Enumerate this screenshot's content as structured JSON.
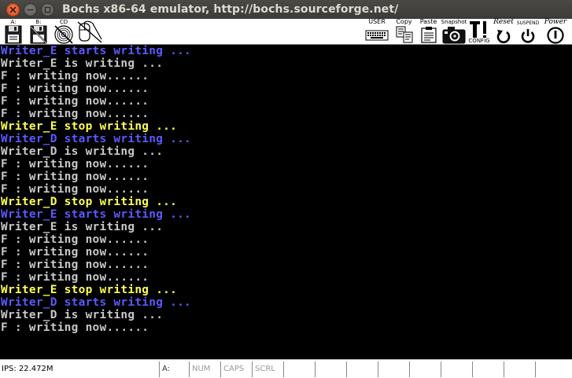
{
  "window": {
    "title": "Bochs x86-64 emulator, http://bochs.sourceforge.net/"
  },
  "toolbar": {
    "floppy_a_label": "A:",
    "floppy_b_label": "B:",
    "cdrom_label": "CD",
    "user_label": "USER",
    "copy_label": "Copy",
    "paste_label": "Paste",
    "snapshot_label": "Snapshot",
    "config_label": "CONFIG",
    "reset_label": "Reset",
    "suspend_label": "SUSPEND",
    "power_label": "Power"
  },
  "colors": {
    "white_text": "#c8c8c8",
    "blue_text": "#5a5aff",
    "yellow_text": "#ffff55"
  },
  "console": {
    "lines": [
      {
        "text": "Writer_E starts writing ...",
        "color": "blue"
      },
      {
        "text": "Writer_E is writing ...",
        "color": "white"
      },
      {
        "text": "F : writing now......",
        "color": "white"
      },
      {
        "text": "F : writing now......",
        "color": "white"
      },
      {
        "text": "F : writing now......",
        "color": "white"
      },
      {
        "text": "F : writing now......",
        "color": "white"
      },
      {
        "text": "Writer_E stop writing ...",
        "color": "yellow"
      },
      {
        "text": "Writer_D starts writing ...",
        "color": "blue"
      },
      {
        "text": "Writer_D is writing ...",
        "color": "white"
      },
      {
        "text": "F : writing now......",
        "color": "white"
      },
      {
        "text": "F : writing now......",
        "color": "white"
      },
      {
        "text": "F : writing now......",
        "color": "white"
      },
      {
        "text": "Writer_D stop writing ...",
        "color": "yellow"
      },
      {
        "text": "Writer_E starts writing ...",
        "color": "blue"
      },
      {
        "text": "Writer_E is writing ...",
        "color": "white"
      },
      {
        "text": "F : writing now......",
        "color": "white"
      },
      {
        "text": "F : writing now......",
        "color": "white"
      },
      {
        "text": "F : writing now......",
        "color": "white"
      },
      {
        "text": "F : writing now......",
        "color": "white"
      },
      {
        "text": "Writer_E stop writing ...",
        "color": "yellow"
      },
      {
        "text": "Writer_D starts writing ...",
        "color": "blue"
      },
      {
        "text": "Writer_D is writing ...",
        "color": "white"
      },
      {
        "text": "F : writing now......",
        "color": "white"
      }
    ]
  },
  "statusbar": {
    "ips": "IPS: 22.472M",
    "drive": "A:",
    "num": "NUM",
    "caps": "CAPS",
    "scrl": "SCRL"
  }
}
